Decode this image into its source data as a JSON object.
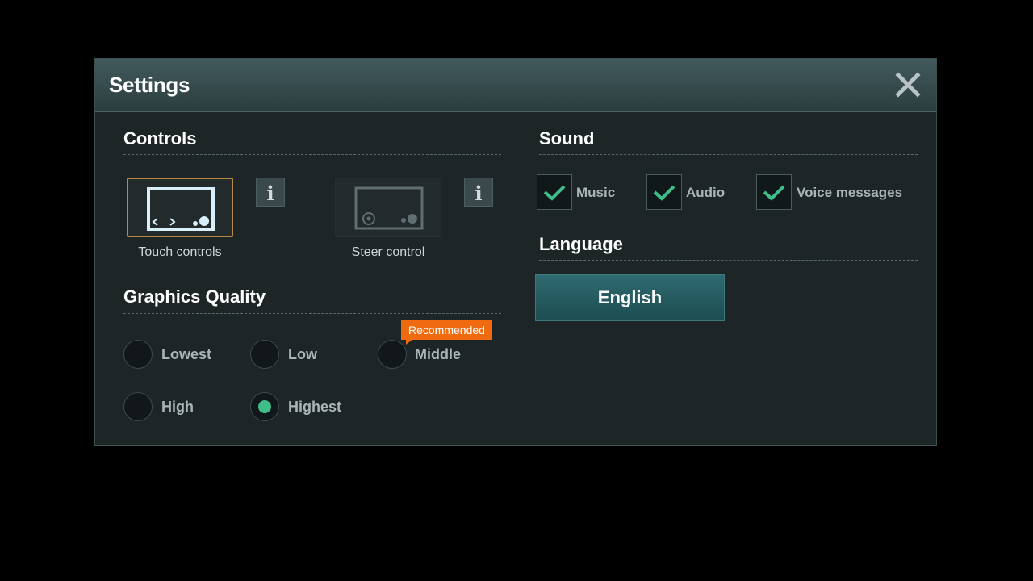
{
  "dialog": {
    "title": "Settings",
    "close_icon": "close-icon"
  },
  "controls": {
    "heading": "Controls",
    "options": [
      {
        "label": "Touch controls",
        "selected": true,
        "icon": "touch-controls-icon"
      },
      {
        "label": "Steer control",
        "selected": false,
        "icon": "steer-control-icon"
      }
    ],
    "info_label": "i"
  },
  "graphics": {
    "heading": "Graphics Quality",
    "options": [
      {
        "label": "Lowest",
        "selected": false
      },
      {
        "label": "Low",
        "selected": false
      },
      {
        "label": "Middle",
        "selected": false
      },
      {
        "label": "High",
        "selected": false
      },
      {
        "label": "Highest",
        "selected": true
      }
    ],
    "recommended_badge": "Recommended"
  },
  "sound": {
    "heading": "Sound",
    "options": [
      {
        "label": "Music",
        "checked": true
      },
      {
        "label": "Audio",
        "checked": true
      },
      {
        "label": "Voice messages",
        "checked": true
      }
    ]
  },
  "language": {
    "heading": "Language",
    "current": "English"
  },
  "colors": {
    "accent_green": "#3fbe8a",
    "badge_orange": "#f06a10",
    "selected_border": "#b58a3c"
  }
}
